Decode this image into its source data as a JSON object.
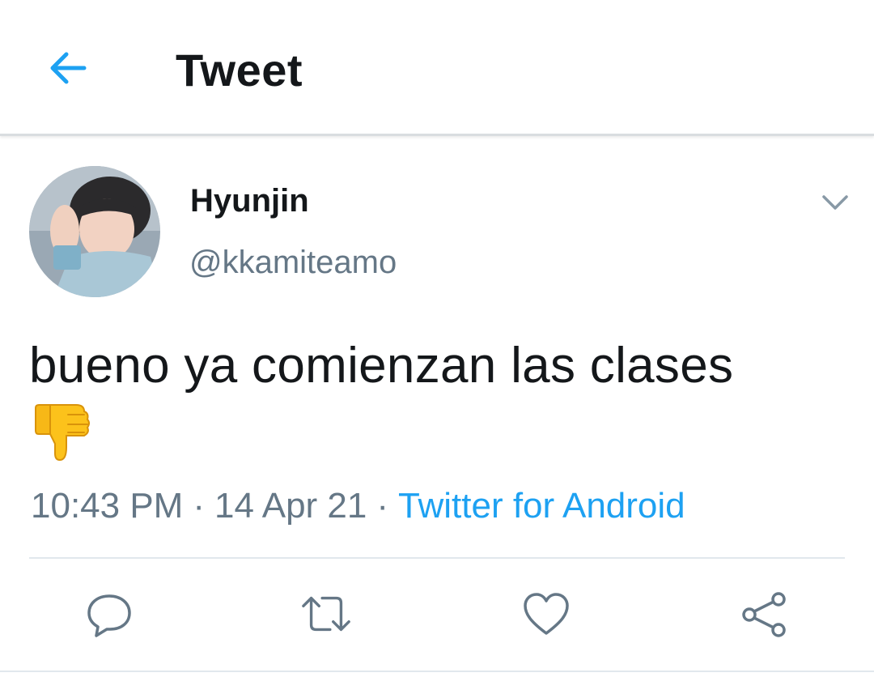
{
  "header": {
    "title": "Tweet",
    "back_icon": "arrow-left-icon",
    "accent_color": "#1da1f2"
  },
  "tweet": {
    "author": {
      "display_name": "Hyunjin",
      "handle": "@kkamiteamo"
    },
    "text": "bueno ya comienzan las clases",
    "emoji": "thumbs-down",
    "time": "10:43 PM",
    "date": "14 Apr 21",
    "separator": "·",
    "source": "Twitter for Android",
    "menu_icon": "chevron-down-icon"
  },
  "actions": [
    {
      "name": "reply",
      "icon": "reply-icon"
    },
    {
      "name": "retweet",
      "icon": "retweet-icon"
    },
    {
      "name": "like",
      "icon": "heart-icon"
    },
    {
      "name": "share",
      "icon": "share-icon"
    }
  ],
  "colors": {
    "text_primary": "#14171a",
    "text_secondary": "#657786",
    "link": "#1da1f2",
    "divider": "#e1e8ed"
  }
}
